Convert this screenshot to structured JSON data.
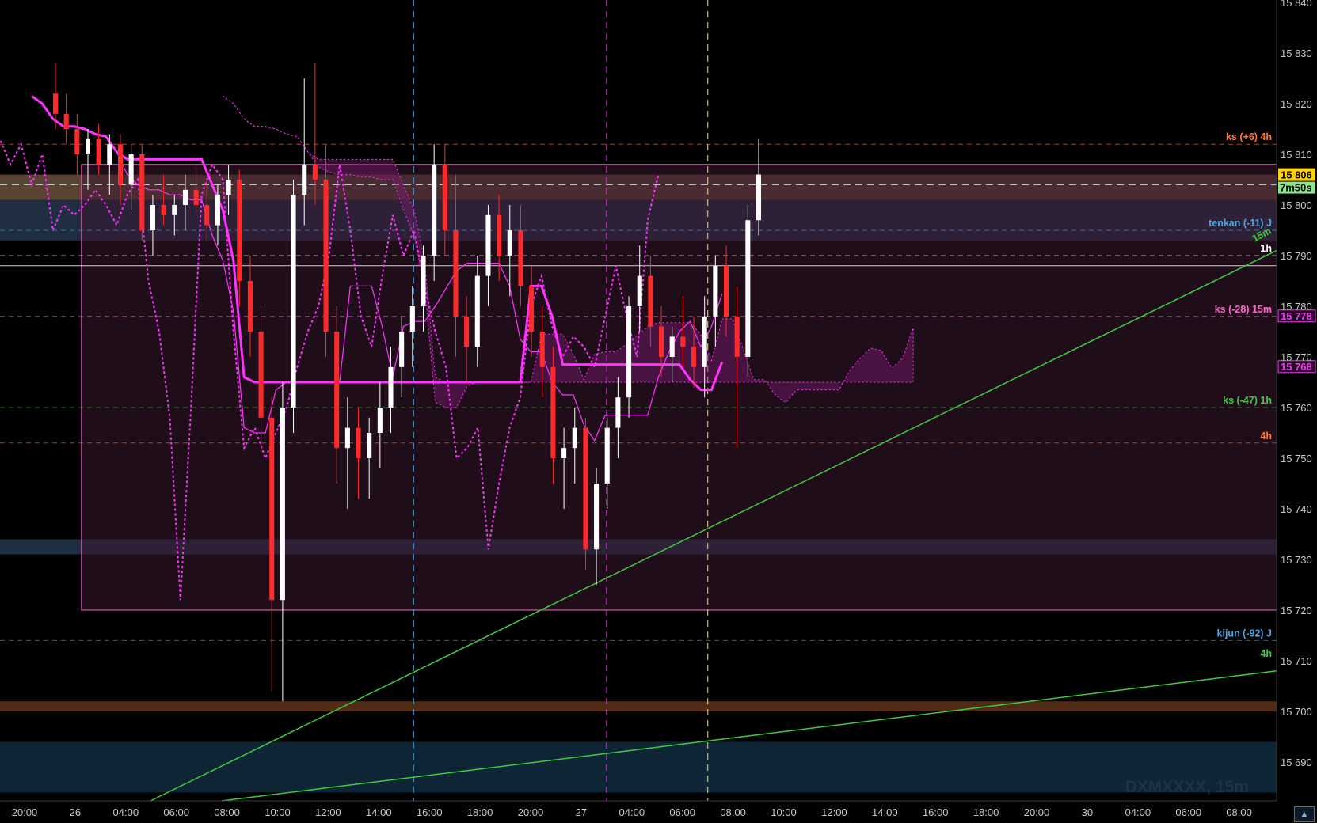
{
  "window": {
    "watermark": "DXMXXXX, 15m"
  },
  "colors": {
    "bull": "#ffffff",
    "bear": "#ff2a2a",
    "magenta": "#ff33ff",
    "trend": "#3ecb3e",
    "orange": "#ff7b2e",
    "blue": "#4aa6e6"
  },
  "chart_data": {
    "type": "candlestick",
    "symbol": "DXMXXXX",
    "timeframe": "15m",
    "y_ticks": [
      15690,
      15700,
      15710,
      15720,
      15730,
      15740,
      15750,
      15760,
      15770,
      15780,
      15790,
      15800,
      15810,
      15820,
      15830,
      15840
    ],
    "x_ticks": [
      "20:00",
      "26",
      "04:00",
      "06:00",
      "08:00",
      "10:00",
      "12:00",
      "14:00",
      "16:00",
      "18:00",
      "20:00",
      "27",
      "04:00",
      "06:00",
      "08:00",
      "10:00",
      "12:00",
      "14:00",
      "16:00",
      "18:00",
      "20:00",
      "30",
      "04:00",
      "06:00",
      "08:00"
    ],
    "current_price": "15 806",
    "countdown": "7m50s",
    "right_badges": [
      {
        "text": "15 778",
        "value": 15778,
        "color": "#ff33ff"
      },
      {
        "text": "15 768",
        "value": 15768,
        "color": "#ff33ff"
      }
    ],
    "level_labels": [
      {
        "text": "ks (+6) 4h",
        "value": 15812,
        "color": "#ff7b2e"
      },
      {
        "text": "tenkan (-11) J",
        "value": 15795,
        "color": "#4aa6e6"
      },
      {
        "text": "1h",
        "value": 15790,
        "color": "#ffffff"
      },
      {
        "text": "ks (-28) 15m",
        "value": 15778,
        "color": "#ff66cc"
      },
      {
        "text": "ks (-47) 1h",
        "value": 15760,
        "color": "#3ecb3e"
      },
      {
        "text": "4h",
        "value": 15753,
        "color": "#ff7b2e"
      },
      {
        "text": "kijun (-92) J",
        "value": 15714,
        "color": "#4aa6e6"
      },
      {
        "text": "4h",
        "value": 15710,
        "color": "#3ecb3e"
      }
    ],
    "trend_labels": [
      {
        "text": "15m",
        "color": "#3ecb3e"
      }
    ],
    "range_box": {
      "from_tick": "26",
      "top": 15808,
      "bottom": 15720
    },
    "zones": [
      {
        "top": 15806,
        "bottom": 15801,
        "color": "#7a5a45"
      },
      {
        "top": 15801,
        "bottom": 15793,
        "color": "#2a3d55"
      },
      {
        "top": 15734,
        "bottom": 15731,
        "color": "#2a3d55"
      },
      {
        "top": 15702,
        "bottom": 15700,
        "color": "#6b3a1c"
      },
      {
        "top": 15694,
        "bottom": 15684,
        "color": "#133247"
      }
    ],
    "candles_ohlc": [
      [
        15822,
        15828,
        15815,
        15818
      ],
      [
        15818,
        15822,
        15812,
        15815
      ],
      [
        15815,
        15818,
        15806,
        15810
      ],
      [
        15810,
        15815,
        15803,
        15813
      ],
      [
        15813,
        15816,
        15806,
        15808
      ],
      [
        15808,
        15814,
        15802,
        15812
      ],
      [
        15812,
        15814,
        15800,
        15804
      ],
      [
        15804,
        15812,
        15799,
        15810
      ],
      [
        15810,
        15812,
        15793,
        15795
      ],
      [
        15795,
        15802,
        15790,
        15800
      ],
      [
        15800,
        15806,
        15796,
        15798
      ],
      [
        15798,
        15802,
        15794,
        15800
      ],
      [
        15800,
        15806,
        15795,
        15803
      ],
      [
        15803,
        15808,
        15798,
        15800
      ],
      [
        15800,
        15805,
        15793,
        15796
      ],
      [
        15796,
        15804,
        15792,
        15802
      ],
      [
        15802,
        15808,
        15798,
        15805
      ],
      [
        15805,
        15807,
        15780,
        15785
      ],
      [
        15785,
        15790,
        15770,
        15775
      ],
      [
        15775,
        15780,
        15750,
        15758
      ],
      [
        15758,
        15762,
        15704,
        15722
      ],
      [
        15722,
        15765,
        15702,
        15760
      ],
      [
        15760,
        15805,
        15755,
        15802
      ],
      [
        15802,
        15825,
        15796,
        15808
      ],
      [
        15808,
        15828,
        15800,
        15805
      ],
      [
        15805,
        15812,
        15770,
        15775
      ],
      [
        15775,
        15780,
        15745,
        15752
      ],
      [
        15752,
        15762,
        15740,
        15756
      ],
      [
        15756,
        15760,
        15742,
        15750
      ],
      [
        15750,
        15758,
        15742,
        15755
      ],
      [
        15755,
        15765,
        15748,
        15760
      ],
      [
        15760,
        15772,
        15755,
        15768
      ],
      [
        15768,
        15778,
        15762,
        15775
      ],
      [
        15775,
        15784,
        15768,
        15780
      ],
      [
        15780,
        15792,
        15775,
        15790
      ],
      [
        15790,
        15812,
        15785,
        15808
      ],
      [
        15808,
        15812,
        15790,
        15795
      ],
      [
        15795,
        15806,
        15770,
        15778
      ],
      [
        15778,
        15782,
        15765,
        15772
      ],
      [
        15772,
        15790,
        15768,
        15786
      ],
      [
        15786,
        15800,
        15780,
        15798
      ],
      [
        15798,
        15802,
        15785,
        15790
      ],
      [
        15790,
        15800,
        15782,
        15795
      ],
      [
        15795,
        15800,
        15780,
        15784
      ],
      [
        15784,
        15788,
        15770,
        15775
      ],
      [
        15775,
        15780,
        15762,
        15768
      ],
      [
        15768,
        15772,
        15745,
        15750
      ],
      [
        15750,
        15756,
        15740,
        15752
      ],
      [
        15752,
        15760,
        15745,
        15756
      ],
      [
        15756,
        15758,
        15728,
        15732
      ],
      [
        15732,
        15748,
        15725,
        15745
      ],
      [
        15745,
        15758,
        15740,
        15756
      ],
      [
        15756,
        15766,
        15750,
        15762
      ],
      [
        15762,
        15782,
        15758,
        15780
      ],
      [
        15780,
        15792,
        15775,
        15786
      ],
      [
        15786,
        15790,
        15772,
        15776
      ],
      [
        15776,
        15780,
        15766,
        15770
      ],
      [
        15770,
        15776,
        15765,
        15774
      ],
      [
        15774,
        15782,
        15768,
        15772
      ],
      [
        15772,
        15778,
        15764,
        15768
      ],
      [
        15768,
        15782,
        15762,
        15778
      ],
      [
        15778,
        15790,
        15772,
        15788
      ],
      [
        15788,
        15792,
        15774,
        15778
      ],
      [
        15778,
        15784,
        15752,
        15770
      ],
      [
        15770,
        15800,
        15766,
        15797
      ],
      [
        15797,
        15813,
        15794,
        15806
      ]
    ]
  }
}
